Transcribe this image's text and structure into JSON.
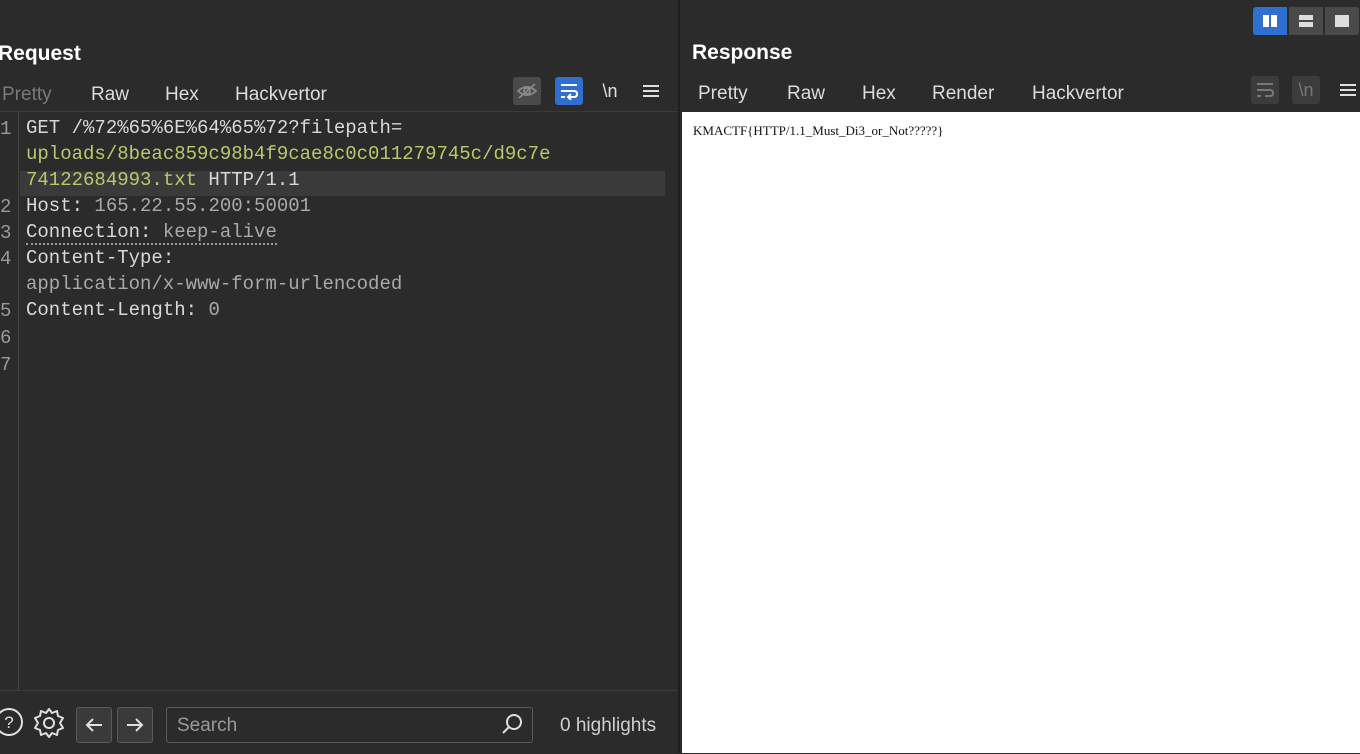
{
  "request": {
    "title": "Request",
    "tabs": [
      {
        "label": "Pretty",
        "state": "disabled"
      },
      {
        "label": "Raw",
        "state": "active"
      },
      {
        "label": "Hex",
        "state": "normal"
      },
      {
        "label": "Hackvertor",
        "state": "normal"
      }
    ],
    "toolbar_icons": [
      "hide-non-printable-icon",
      "wrap-lines-icon",
      "newline-icon",
      "menu-icon"
    ],
    "newline_label": "\\n",
    "line_numbers": [
      "1",
      "2",
      "3",
      "4",
      "5",
      "6",
      "7"
    ],
    "lines": {
      "l1": "GET /%72%65%6E%64%65%72?filepath=",
      "l1_cont_url": "uploads/8beac859c98b4f9cae8c0c011279745c/d9c7e",
      "l1_cont2_url": "74122684993.txt",
      "l1_cont2_rest": " HTTP/1.1",
      "l2_key": "Host: ",
      "l2_val": "165.22.55.200:50001",
      "l3_key": "Connection: ",
      "l3_val": "keep-alive",
      "l4_key": "Content-Type:",
      "l4_val": "application/x-www-form-urlencoded",
      "l5_key": "Content-Length: ",
      "l5_val": "0"
    },
    "bottom": {
      "search_placeholder": "Search",
      "highlights": "0 highlights"
    }
  },
  "response": {
    "title": "Response",
    "tabs": [
      {
        "label": "Pretty",
        "state": "normal"
      },
      {
        "label": "Raw",
        "state": "normal"
      },
      {
        "label": "Hex",
        "state": "normal"
      },
      {
        "label": "Render",
        "state": "active"
      },
      {
        "label": "Hackvertor",
        "state": "normal"
      }
    ],
    "render_text": "KMACTF{HTTP/1.1_Must_Di3_or_Not?????}"
  },
  "layout_toggles": [
    "split-vertical-icon",
    "split-horizontal-icon",
    "single-pane-icon"
  ],
  "colors": {
    "accent_tab": "#e8703a",
    "active_icon": "#2f6fd1",
    "url_text": "#b8c96a"
  }
}
